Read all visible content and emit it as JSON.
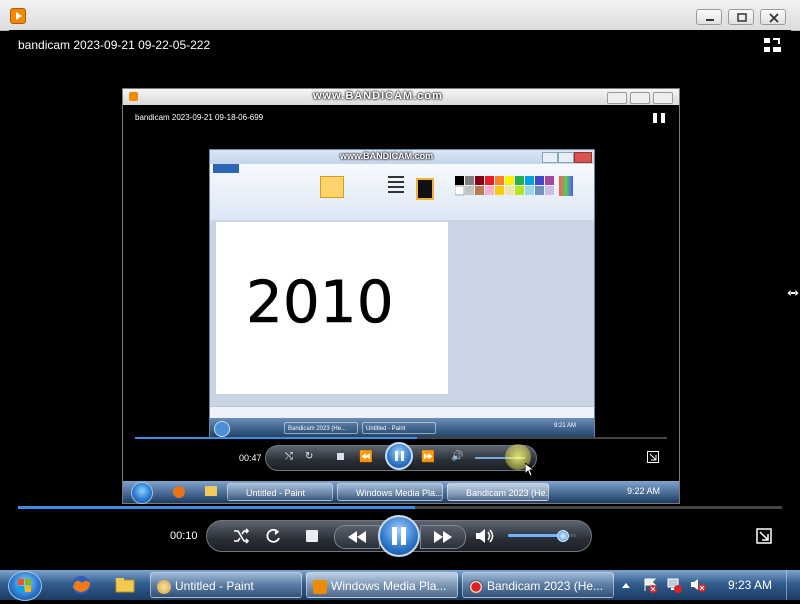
{
  "window": {
    "title_icon": "wmp-icon",
    "controls": [
      "minimize",
      "maximize",
      "close"
    ]
  },
  "video": {
    "title": "bandicam 2023-09-21 09-22-05-222",
    "switch_icon": "switch-to-library-icon",
    "seek_fraction": 0.52
  },
  "inner_player": {
    "watermark": "www.BANDICAM.com",
    "title": "bandicam 2023-09-21 09-18-06-699",
    "time": "00:47",
    "seek_fraction": 0.53,
    "paint": {
      "watermark": "www.BANDICAM.com",
      "drawing_text": "2010",
      "taskbar_items": [
        "Bandicam 2023 (He...",
        "Untitled - Paint"
      ],
      "tray_time": "9:21 AM"
    },
    "taskbar": {
      "items": [
        "Untitled - Paint",
        "Windows Media Pla...",
        "Bandicam 2023 (He..."
      ],
      "time": "9:22 AM"
    }
  },
  "controls": {
    "time": "00:10",
    "volume_fraction": 0.8
  },
  "taskbar": {
    "items": [
      {
        "label": "Untitled - Paint",
        "icon": "paint-icon"
      },
      {
        "label": "Windows Media Pla...",
        "icon": "wmp-icon"
      },
      {
        "label": "Bandicam 2023 (He...",
        "icon": "bandicam-record-icon"
      }
    ],
    "time": "9:23 AM",
    "colors": {
      "accent": "#2c74c9",
      "taskbar": "#325d8e"
    }
  }
}
